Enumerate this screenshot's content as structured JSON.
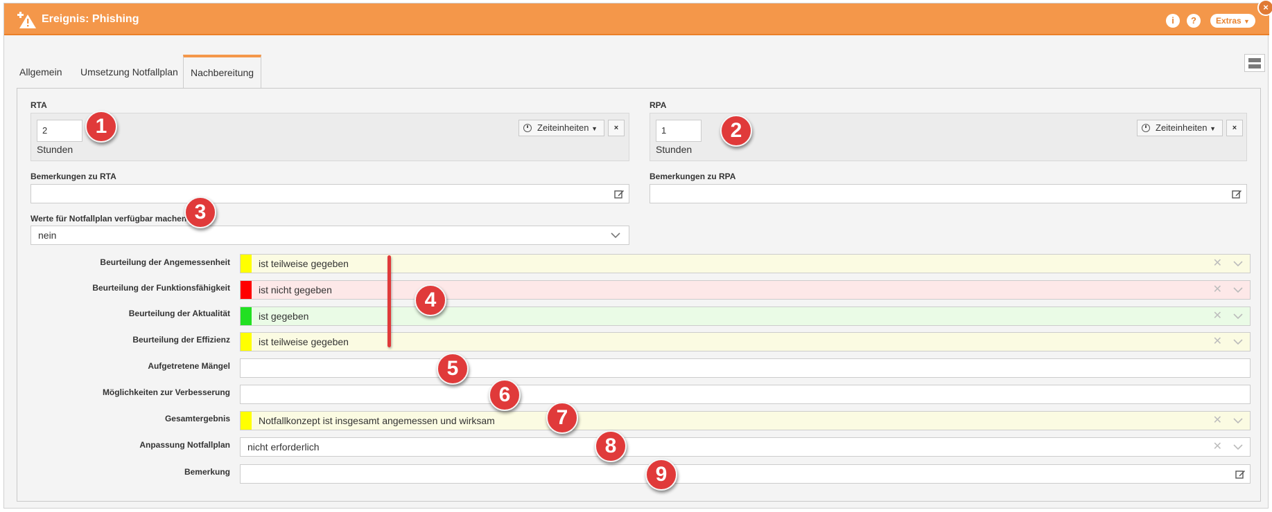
{
  "window": {
    "title": "Ereignis: Phishing",
    "info_glyph": "i",
    "help_glyph": "?",
    "extras_label": "Extras",
    "close_glyph": "×",
    "accent_color": "#f4974a"
  },
  "tabs": [
    {
      "label": "Allgemein",
      "active": false
    },
    {
      "label": "Umsetzung Notfallplan",
      "active": false
    },
    {
      "label": "Nachbereitung",
      "active": true
    }
  ],
  "rta": {
    "label": "RTA",
    "value": "2",
    "unit": "Stunden",
    "zeiteinheiten_label": "Zeiteinheiten",
    "remove_glyph": "×"
  },
  "rpa": {
    "label": "RPA",
    "value": "1",
    "unit": "Stunden",
    "zeiteinheiten_label": "Zeiteinheiten",
    "remove_glyph": "×"
  },
  "remarks": {
    "rta_label": "Bemerkungen zu RTA",
    "rta_value": "",
    "rpa_label": "Bemerkungen zu RPA",
    "rpa_value": ""
  },
  "notfallplan_values": {
    "label": "Werte für Notfallplan verfügbar machen",
    "value": "nein"
  },
  "assessment": [
    {
      "label": "Beurteilung der Angemessenheit",
      "value": "ist teilweise gegeben",
      "status_color": "#ffff00",
      "bg_color": "#fbfbe2"
    },
    {
      "label": "Beurteilung der Funktionsfähigkeit",
      "value": "ist nicht gegeben",
      "status_color": "#ff0000",
      "bg_color": "#fde8e8"
    },
    {
      "label": "Beurteilung der Aktualität",
      "value": "ist gegeben",
      "status_color": "#22e022",
      "bg_color": "#eafbe6"
    },
    {
      "label": "Beurteilung der Effizienz",
      "value": "ist teilweise gegeben",
      "status_color": "#ffff00",
      "bg_color": "#fbfbe2"
    }
  ],
  "fields": {
    "maengel_label": "Aufgetretene Mängel",
    "maengel_value": "",
    "verbesserung_label": "Möglichkeiten zur Verbesserung",
    "verbesserung_value": "",
    "gesamt_label": "Gesamtergebnis",
    "gesamt_value": "Notfallkonzept ist insgesamt angemessen und wirksam",
    "gesamt_status_color": "#ffff00",
    "gesamt_bg_color": "#fbfbe2",
    "anpassung_label": "Anpassung Notfallplan",
    "anpassung_value": "nicht erforderlich",
    "bemerkung_label": "Bemerkung",
    "bemerkung_value": ""
  },
  "clear_glyph": "✕",
  "callouts": [
    "1",
    "2",
    "3",
    "4",
    "5",
    "6",
    "7",
    "8",
    "9"
  ]
}
